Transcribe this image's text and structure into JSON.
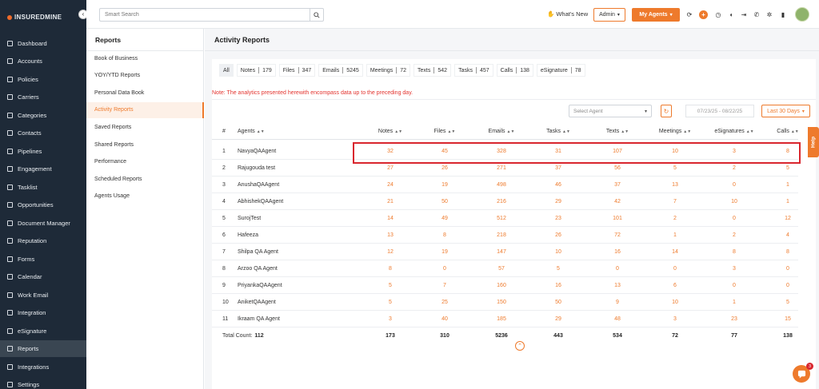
{
  "brand": {
    "name": "INSUREDMINE"
  },
  "sidebar": {
    "items": [
      {
        "label": "Dashboard",
        "icon": "dashboard-icon"
      },
      {
        "label": "Accounts",
        "icon": "accounts-icon"
      },
      {
        "label": "Policies",
        "icon": "policies-icon"
      },
      {
        "label": "Carriers",
        "icon": "carriers-icon"
      },
      {
        "label": "Categories",
        "icon": "categories-icon"
      },
      {
        "label": "Contacts",
        "icon": "contacts-icon"
      },
      {
        "label": "Pipelines",
        "icon": "pipelines-icon"
      },
      {
        "label": "Engagement",
        "icon": "engagement-icon"
      },
      {
        "label": "Tasklist",
        "icon": "tasklist-icon"
      },
      {
        "label": "Opportunities",
        "icon": "opportunities-icon"
      },
      {
        "label": "Document Manager",
        "icon": "document-manager-icon"
      },
      {
        "label": "Reputation",
        "icon": "reputation-icon"
      },
      {
        "label": "Forms",
        "icon": "forms-icon"
      },
      {
        "label": "Calendar",
        "icon": "calendar-icon"
      },
      {
        "label": "Work Email",
        "icon": "work-email-icon"
      },
      {
        "label": "Integration",
        "icon": "integration-icon"
      },
      {
        "label": "eSignature",
        "icon": "esignature-icon"
      },
      {
        "label": "Reports",
        "icon": "reports-icon",
        "active": true
      },
      {
        "label": "Integrations",
        "icon": "integrations-icon"
      },
      {
        "label": "Settings",
        "icon": "settings-icon"
      }
    ]
  },
  "reports_menu": {
    "title": "Reports",
    "items": [
      {
        "label": "Book of Business"
      },
      {
        "label": "YOY/YTD Reports"
      },
      {
        "label": "Personal Data Book"
      },
      {
        "label": "Activity Reports",
        "active": true
      },
      {
        "label": "Saved Reports"
      },
      {
        "label": "Shared Reports"
      },
      {
        "label": "Performance"
      },
      {
        "label": "Scheduled Reports"
      },
      {
        "label": "Agents Usage"
      }
    ]
  },
  "topbar": {
    "search_placeholder": "Smart Search",
    "whats_new": "What's New",
    "admin_label": "Admin",
    "my_agents_label": "My Agents",
    "chat_badge": "3"
  },
  "page": {
    "title": "Activity Reports",
    "tabs": [
      {
        "label": "All",
        "count": ""
      },
      {
        "label": "Notes",
        "count": "179"
      },
      {
        "label": "Files",
        "count": "347"
      },
      {
        "label": "Emails",
        "count": "5245"
      },
      {
        "label": "Meetings",
        "count": "72"
      },
      {
        "label": "Texts",
        "count": "542"
      },
      {
        "label": "Tasks",
        "count": "457"
      },
      {
        "label": "Calls",
        "count": "138"
      },
      {
        "label": "eSignature",
        "count": "78"
      }
    ],
    "note": "Note: The analytics presented herewith encompass data up to the preceding day.",
    "select_agent_placeholder": "Select Agent",
    "date_range": "07/23/25 - 08/22/25",
    "period_label": "Last 30 Days",
    "help_label": "Help"
  },
  "table": {
    "headers": [
      "#",
      "Agents",
      "Notes",
      "Files",
      "Emails",
      "Tasks",
      "Texts",
      "Meetings",
      "eSignatures",
      "Calls"
    ],
    "rows": [
      [
        "1",
        "NavyaQAAgent",
        "32",
        "45",
        "328",
        "31",
        "107",
        "10",
        "3",
        "8"
      ],
      [
        "2",
        "Rajugouda test",
        "27",
        "26",
        "271",
        "37",
        "56",
        "5",
        "2",
        "5"
      ],
      [
        "3",
        "AnushaQAAgent",
        "24",
        "19",
        "498",
        "46",
        "37",
        "13",
        "0",
        "1"
      ],
      [
        "4",
        "AbhishekQAAgent",
        "21",
        "50",
        "216",
        "29",
        "42",
        "7",
        "10",
        "1"
      ],
      [
        "5",
        "SurojTest",
        "14",
        "49",
        "512",
        "23",
        "101",
        "2",
        "0",
        "12"
      ],
      [
        "6",
        "Hafeeza",
        "13",
        "8",
        "218",
        "26",
        "72",
        "1",
        "2",
        "4"
      ],
      [
        "7",
        "Shilpa QA Agent",
        "12",
        "19",
        "147",
        "10",
        "16",
        "14",
        "8",
        "8"
      ],
      [
        "8",
        "Arzoo QA Agent",
        "8",
        "0",
        "57",
        "5",
        "0",
        "0",
        "3",
        "0"
      ],
      [
        "9",
        "PriyankaQAAgent",
        "5",
        "7",
        "160",
        "16",
        "13",
        "6",
        "0",
        "0"
      ],
      [
        "10",
        "AniketQAAgent",
        "5",
        "25",
        "150",
        "50",
        "9",
        "10",
        "1",
        "5"
      ],
      [
        "11",
        "Ikraam QA Agent",
        "3",
        "40",
        "185",
        "29",
        "48",
        "3",
        "23",
        "15"
      ]
    ],
    "total_label": "Total Count:",
    "total_count": "112",
    "totals": [
      "173",
      "310",
      "5236",
      "443",
      "534",
      "72",
      "77",
      "138"
    ]
  },
  "colors": {
    "accent": "#ee7a2c",
    "sidebar": "#1e2a38",
    "highlight_box": "#d9262e"
  }
}
